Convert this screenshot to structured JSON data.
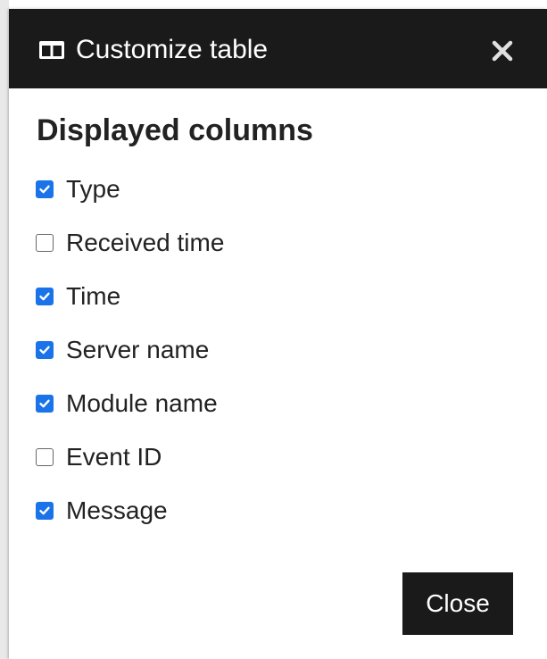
{
  "dialog": {
    "title": "Customize table",
    "header_icon": "columns-icon",
    "close_icon": "close-icon"
  },
  "section": {
    "title": "Displayed columns"
  },
  "columns": [
    {
      "label": "Type",
      "checked": true
    },
    {
      "label": "Received time",
      "checked": false
    },
    {
      "label": "Time",
      "checked": true
    },
    {
      "label": "Server name",
      "checked": true
    },
    {
      "label": "Module name",
      "checked": true
    },
    {
      "label": "Event ID",
      "checked": false
    },
    {
      "label": "Message",
      "checked": true
    }
  ],
  "footer": {
    "close_label": "Close"
  },
  "colors": {
    "header_bg": "#1a1a1a",
    "checkbox_checked": "#1a73e8",
    "button_bg": "#1a1a1a"
  }
}
